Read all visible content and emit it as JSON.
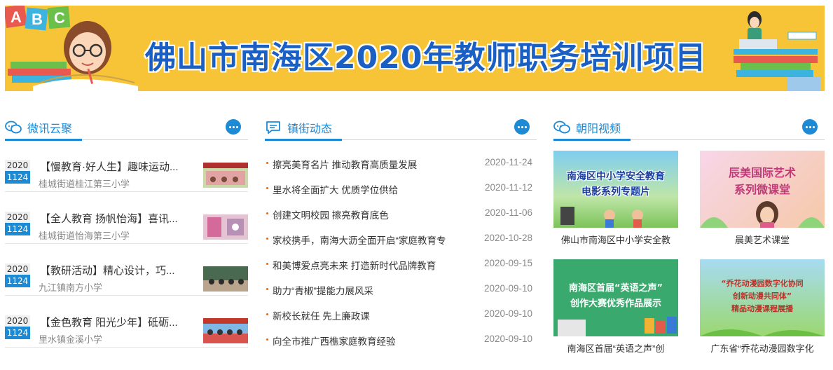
{
  "banner": {
    "title": "佛山市南海区2020年教师职务培训项目",
    "letters": [
      "A",
      "B",
      "C"
    ],
    "colors": {
      "background": "#f8c437",
      "title": "#1a5fc4"
    }
  },
  "sections": {
    "left": {
      "title": "微讯云聚",
      "items": [
        {
          "year": "2020",
          "md": "1124",
          "title": "【慢教育·好人生】趣味运动...",
          "source": "桂城街道桂江第三小学"
        },
        {
          "year": "2020",
          "md": "1124",
          "title": "【全人教育 扬帆怡海】喜讯...",
          "source": "桂城街道怡海第三小学"
        },
        {
          "year": "2020",
          "md": "1124",
          "title": "【教研活动】精心设计，巧...",
          "source": "九江镇南方小学"
        },
        {
          "year": "2020",
          "md": "1124",
          "title": "【金色教育 阳光少年】砥砺...",
          "source": "里水镇金溪小学"
        }
      ]
    },
    "middle": {
      "title": "镇街动态",
      "items": [
        {
          "title": "擦亮美育名片 推动教育高质量发展",
          "date": "2020-11-24"
        },
        {
          "title": "里水将全面扩大 优质学位供给",
          "date": "2020-11-12"
        },
        {
          "title": "创建文明校园 擦亮教育底色",
          "date": "2020-11-06"
        },
        {
          "title": "家校携手，南海大沥全面开启“家庭教育专",
          "date": "2020-10-28"
        },
        {
          "title": "和美博爱点亮未来 打造新时代品牌教育",
          "date": "2020-09-15"
        },
        {
          "title": "助力“青椒”提能力展风采",
          "date": "2020-09-10"
        },
        {
          "title": "新校长就任 先上廉政课",
          "date": "2020-09-10"
        },
        {
          "title": "向全市推广西樵家庭教育经验",
          "date": "2020-09-10"
        }
      ]
    },
    "right": {
      "title": "朝阳视频",
      "videos": [
        {
          "thumb_text": [
            "南海区中小学安全教育",
            "电影系列专题片"
          ],
          "caption": "佛山市南海区中小学安全教"
        },
        {
          "thumb_text": [
            "辰美国际艺术",
            "系列微课堂"
          ],
          "caption": "晨美艺术课堂"
        },
        {
          "thumb_text": [
            "南海区首届“英语之声”",
            "创作大赛优秀作品展示"
          ],
          "caption": "南海区首届“英语之声”创"
        },
        {
          "thumb_text": [
            "“乔花动漫园数字化协同",
            "创新动漫共同体”",
            "精品动漫课程展播"
          ],
          "caption": "广东省“乔花动漫园数字化"
        }
      ]
    }
  },
  "accent_color": "#1d8ad6"
}
